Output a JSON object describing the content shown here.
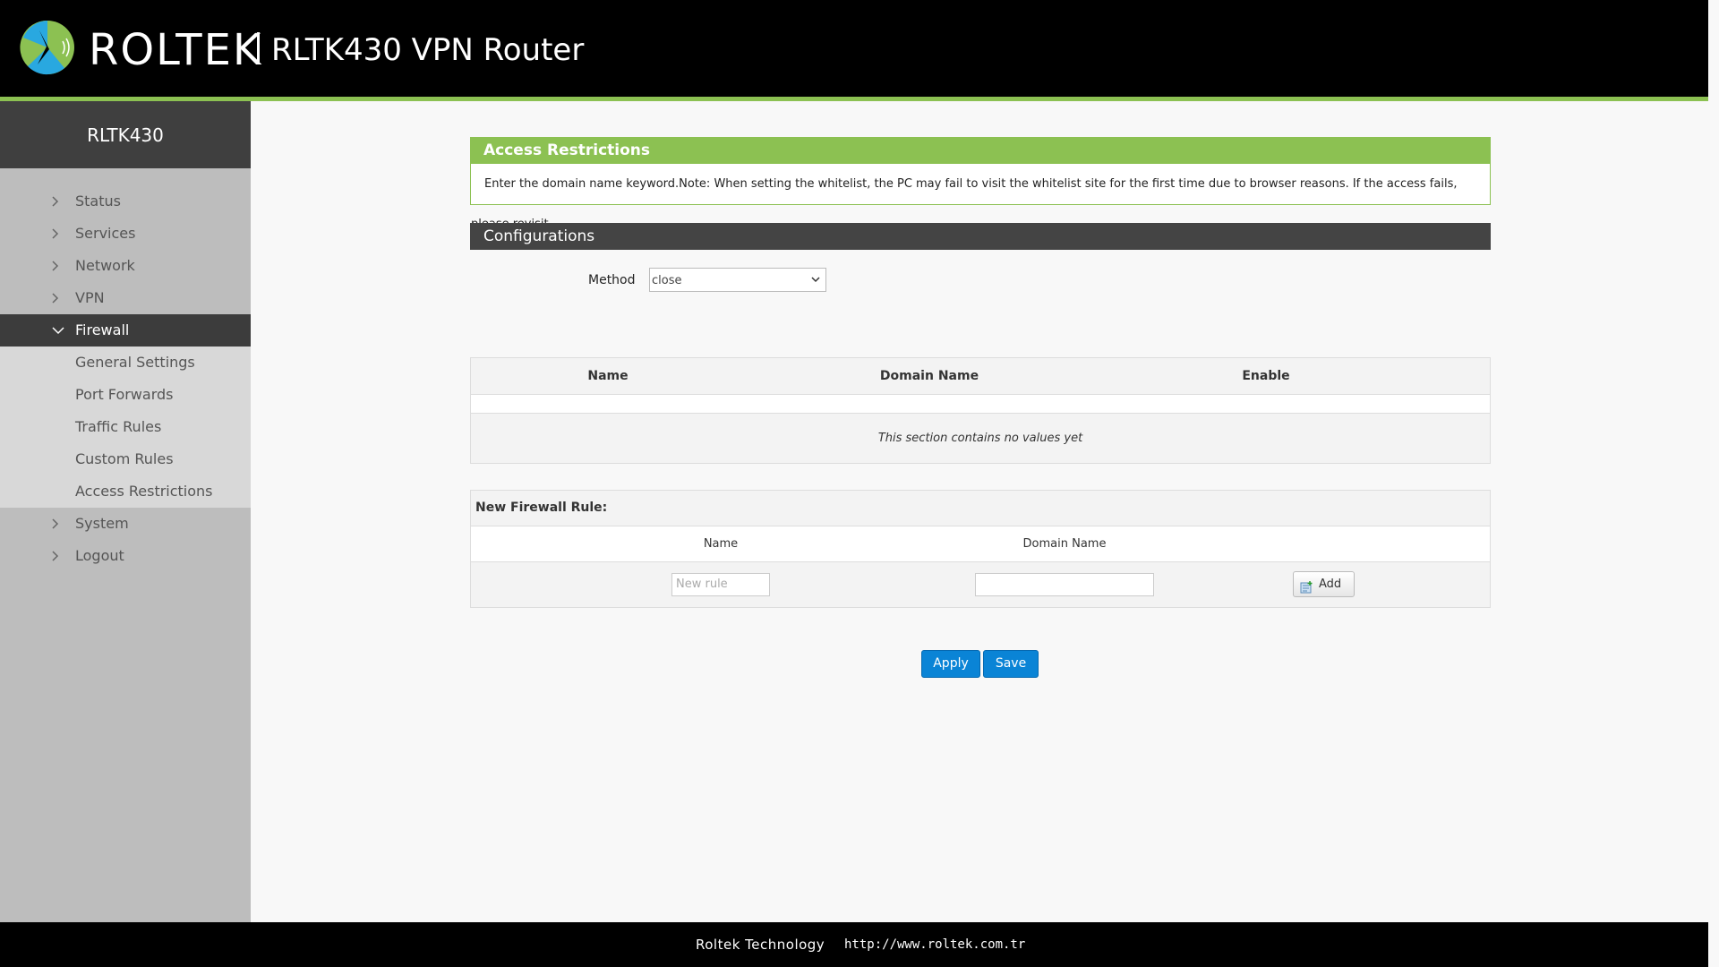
{
  "header": {
    "brand": "ROLTEK",
    "product": "RLTK430 VPN Router",
    "accent_color": "#8cc152"
  },
  "sidebar": {
    "device": "RLTK430",
    "items": [
      {
        "label": "Status",
        "icon": "chevron-right-icon"
      },
      {
        "label": "Services",
        "icon": "chevron-right-icon"
      },
      {
        "label": "Network",
        "icon": "chevron-right-icon"
      },
      {
        "label": "VPN",
        "icon": "chevron-right-icon"
      },
      {
        "label": "Firewall",
        "icon": "chevron-down-icon",
        "active": true
      },
      {
        "label": "System",
        "icon": "chevron-right-icon"
      },
      {
        "label": "Logout",
        "icon": "chevron-right-icon"
      }
    ],
    "firewall_sub": [
      "General Settings",
      "Port Forwards",
      "Traffic Rules",
      "Custom Rules",
      "Access Restrictions"
    ]
  },
  "main": {
    "notice_title": "Access Restrictions",
    "notice_text": "Enter the domain name keyword.Note: When setting the whitelist, the PC may fail to visit the whitelist site for the first time due to browser reasons. If the access fails, please revisit.",
    "config_title": "Configurations",
    "method_label": "Method",
    "method_value": "close",
    "table": {
      "headers": [
        "Name",
        "Domain Name",
        "Enable"
      ],
      "empty_text": "This section contains no values yet"
    },
    "new_rule": {
      "title": "New Firewall Rule:",
      "headers": [
        "Name",
        "Domain Name"
      ],
      "name_placeholder": "New rule",
      "domain_value": "",
      "add_label": "Add"
    },
    "apply_label": "Apply",
    "save_label": "Save"
  },
  "footer": {
    "company": "Roltek Technology",
    "url": "http://www.roltek.com.tr"
  }
}
